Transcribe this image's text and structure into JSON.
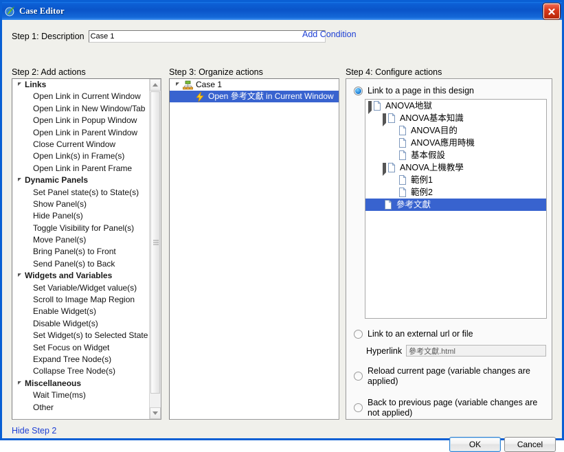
{
  "window": {
    "title": "Case Editor",
    "icon": "axure-logo-icon",
    "close_icon": "close-icon"
  },
  "step1": {
    "label": "Step 1: Description",
    "input_value": "Case 1",
    "input_placeholder": "",
    "add_condition": "Add Condition"
  },
  "step2": {
    "heading": "Step 2: Add actions",
    "items": [
      {
        "label": "Links",
        "type": "group"
      },
      {
        "label": "Open Link in Current Window",
        "type": "item"
      },
      {
        "label": "Open Link in New Window/Tab",
        "type": "item"
      },
      {
        "label": "Open Link in Popup Window",
        "type": "item"
      },
      {
        "label": "Open Link in Parent Window",
        "type": "item"
      },
      {
        "label": "Close Current Window",
        "type": "item"
      },
      {
        "label": "Open Link(s) in Frame(s)",
        "type": "item"
      },
      {
        "label": "Open Link in Parent Frame",
        "type": "item"
      },
      {
        "label": "Dynamic Panels",
        "type": "group"
      },
      {
        "label": "Set Panel state(s) to State(s)",
        "type": "item"
      },
      {
        "label": "Show Panel(s)",
        "type": "item"
      },
      {
        "label": "Hide Panel(s)",
        "type": "item"
      },
      {
        "label": "Toggle Visibility for Panel(s)",
        "type": "item"
      },
      {
        "label": "Move Panel(s)",
        "type": "item"
      },
      {
        "label": "Bring Panel(s) to Front",
        "type": "item"
      },
      {
        "label": "Send Panel(s) to Back",
        "type": "item"
      },
      {
        "label": "Widgets and Variables",
        "type": "group"
      },
      {
        "label": "Set Variable/Widget value(s)",
        "type": "item"
      },
      {
        "label": "Scroll to Image Map Region",
        "type": "item"
      },
      {
        "label": "Enable Widget(s)",
        "type": "item"
      },
      {
        "label": "Disable Widget(s)",
        "type": "item"
      },
      {
        "label": "Set Widget(s) to Selected State",
        "type": "item"
      },
      {
        "label": "Set Focus on Widget",
        "type": "item"
      },
      {
        "label": "Expand Tree Node(s)",
        "type": "item"
      },
      {
        "label": "Collapse Tree Node(s)",
        "type": "item"
      },
      {
        "label": "Miscellaneous",
        "type": "group"
      },
      {
        "label": "Wait Time(ms)",
        "type": "item"
      },
      {
        "label": "Other",
        "type": "item"
      }
    ]
  },
  "step3": {
    "heading": "Step 3: Organize actions",
    "rows": [
      {
        "label": "Case 1",
        "icon": "case-node-icon",
        "depth": 0,
        "expander": true,
        "selected": false
      },
      {
        "label": "Open 參考文獻 in Current Window",
        "icon": "lightning-bolt-icon",
        "depth": 1,
        "expander": false,
        "selected": true
      }
    ]
  },
  "step4": {
    "heading": "Step 4: Configure actions",
    "options": [
      {
        "label": "Link to a page in this design",
        "checked": true
      },
      {
        "label": "Link to an external url or file",
        "checked": false
      },
      {
        "label": "Reload current page (variable changes are applied)",
        "checked": false
      },
      {
        "label": "Back to previous page (variable changes are not applied)",
        "checked": false
      }
    ],
    "page_tree": [
      {
        "label": "ANOVA地獄",
        "depth": 0,
        "expander": true,
        "selected": false
      },
      {
        "label": "ANOVA基本知識",
        "depth": 1,
        "expander": true,
        "selected": false
      },
      {
        "label": "ANOVA目的",
        "depth": 2,
        "expander": false,
        "selected": false
      },
      {
        "label": "ANOVA應用時機",
        "depth": 2,
        "expander": false,
        "selected": false
      },
      {
        "label": "基本假設",
        "depth": 2,
        "expander": false,
        "selected": false
      },
      {
        "label": "ANOVA上機教學",
        "depth": 1,
        "expander": true,
        "selected": false
      },
      {
        "label": "範例1",
        "depth": 2,
        "expander": false,
        "selected": false
      },
      {
        "label": "範例2",
        "depth": 2,
        "expander": false,
        "selected": false
      },
      {
        "label": "參考文獻",
        "depth": 1,
        "expander": false,
        "selected": true
      }
    ],
    "hyperlink_label": "Hyperlink",
    "hyperlink_value": "參考文獻.html"
  },
  "footer": {
    "hide_step2": "Hide Step 2",
    "ok": "OK",
    "cancel": "Cancel"
  },
  "colors": {
    "titlebar_blue": "#0a55c9",
    "selection_blue": "#3863cf",
    "link_blue": "#1d3fd4",
    "window_border": "#0a5fd4",
    "dialog_bg": "#f0f0eb"
  }
}
